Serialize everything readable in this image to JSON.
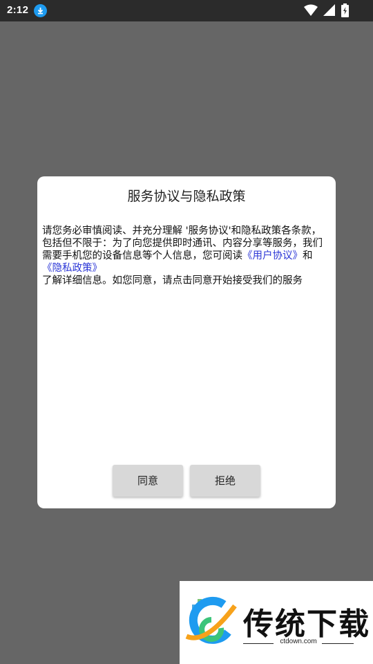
{
  "status_bar": {
    "time": "2:12",
    "icons": [
      "download-icon",
      "wifi-icon",
      "signal-icon",
      "battery-charging-icon"
    ]
  },
  "dialog": {
    "title": "服务协议与隐私政策",
    "body_part1": "请您务必审慎阅读、并充分理解 '服务协议'和隐私政策各条款，包括但不限于：为了向您提供即时通讯、内容分享等服务，我们需要手机您的设备信息等个人信息，您可阅读",
    "link_user_agreement": "《用户协议》",
    "body_and": "和",
    "link_privacy_policy": "《隐私政策》",
    "body_part2": "了解详细信息。如您同意，请点击同意开始接受我们的服务",
    "agree_label": "同意",
    "reject_label": "拒绝"
  },
  "watermark": {
    "name": "传统下载",
    "url": "ctdown.com"
  },
  "colors": {
    "overlay": "#666666",
    "status_bar": "#2b2b2b",
    "link": "#2a35d6",
    "button": "#d8d8d8"
  }
}
